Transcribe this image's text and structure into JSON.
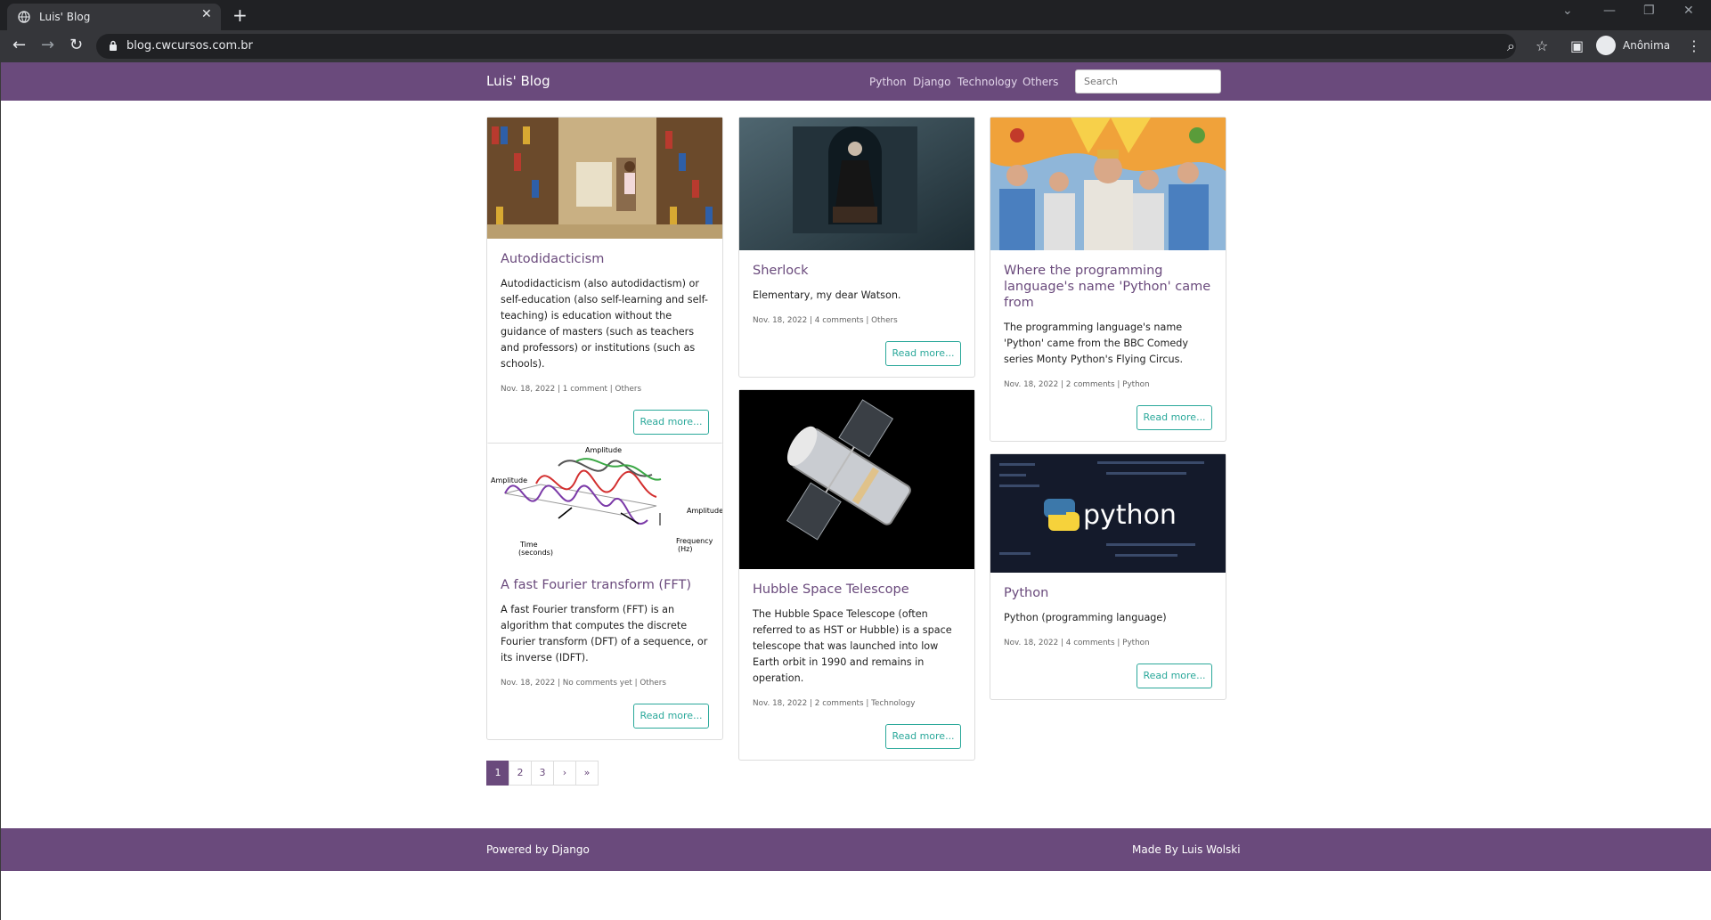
{
  "browser": {
    "tab_title": "Luis' Blog",
    "url": "blog.cwcursos.com.br",
    "profile_label": "Anônima",
    "icons": [
      "back-arrow-icon",
      "forward-arrow-icon",
      "reload-icon",
      "lock-icon",
      "zoom-icon",
      "star-icon",
      "side-panel-icon",
      "incognito-icon",
      "menu-dots-icon"
    ]
  },
  "site": {
    "brand": "Luis' Blog",
    "nav": [
      "Python",
      "Django",
      "Technology",
      "Others"
    ],
    "search_placeholder": "Search",
    "colors": {
      "primary": "#6a4a7c",
      "accent": "#2aa89a"
    }
  },
  "posts": [
    {
      "title": "Autodidacticism",
      "text": "Autodidacticism (also autodidactism) or self-education (also self-learning and self-teaching) is education without the guidance of masters (such as teachers and professors) or institutions (such as schools).",
      "meta": "Nov. 18, 2022 | 1 comment | Others",
      "button": "Read more...",
      "image": "library-photo"
    },
    {
      "title": "Sherlock",
      "text": "Elementary, my dear Watson.",
      "meta": "Nov. 18, 2022 | 4 comments | Others",
      "button": "Read more...",
      "image": "sherlock-photo"
    },
    {
      "title": "Where the programming language's name 'Python' came from",
      "text": "The programming language's name 'Python' came from the BBC Comedy series Monty Python's Flying Circus.",
      "meta": "Nov. 18, 2022 | 2 comments | Python",
      "button": "Read more...",
      "image": "monty-python-photo"
    },
    {
      "title": "A fast Fourier transform (FFT)",
      "text": "A fast Fourier transform (FFT) is an algorithm that computes the discrete Fourier transform (DFT) of a sequence, or its inverse (IDFT).",
      "meta": "Nov. 18, 2022 | No comments yet | Others",
      "button": "Read more...",
      "image": "fft-diagram",
      "image_labels": [
        "Amplitude",
        "Amplitude",
        "Amplitude",
        "Time",
        "(seconds)",
        "Frequency",
        "(Hz)"
      ]
    },
    {
      "title": "Hubble Space Telescope",
      "text": "The Hubble Space Telescope (often referred to as HST or Hubble) is a space telescope that was launched into low Earth orbit in 1990 and remains in operation.",
      "meta": "Nov. 18, 2022 | 2 comments | Technology",
      "button": "Read more...",
      "image": "hubble-photo"
    },
    {
      "title": "Python",
      "text": "Python (programming language)",
      "meta": "Nov. 18, 2022 | 4 comments | Python",
      "button": "Read more...",
      "image": "python-logo",
      "image_text": "python"
    }
  ],
  "pagination": [
    "1",
    "2",
    "3",
    "›",
    "»"
  ],
  "footer": {
    "left": "Powered by Django",
    "right": "Made By Luis Wolski"
  }
}
